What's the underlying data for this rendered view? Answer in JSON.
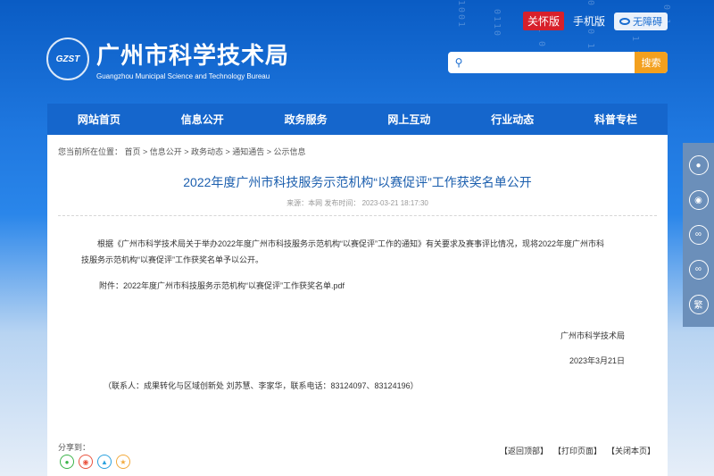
{
  "top": {
    "care_label": "关怀版",
    "mobile_label": "手机版",
    "access_label": "无障碍"
  },
  "logo": {
    "mark": "GZST",
    "name_cn": "广州市科学技术局",
    "name_en": "Guangzhou Municipal Science and Technology Bureau"
  },
  "search": {
    "placeholder": "",
    "button": "搜索"
  },
  "nav": [
    "网站首页",
    "信息公开",
    "政务服务",
    "网上互动",
    "行业动态",
    "科普专栏"
  ],
  "breadcrumb": "您当前所在位置： 首页 > 信息公开 > 政务动态 > 通知通告 > 公示信息",
  "article": {
    "title": "2022年度广州市科技服务示范机构“以赛促评”工作获奖名单公开",
    "meta": "来源：本网    发布时间：  2023-03-21 18:17:30",
    "para_line1": "根据《广州市科学技术局关于举办2022年度广州市科技服务示范机构“以赛促评”工作的通知》有关要求及赛事评比情况，现将2022年度广州市科",
    "para_line2": "技服务示范机构“以赛促评”工作获奖名单予以公开。",
    "attachment": "附件：2022年度广州市科技服务示范机构“以赛促评”工作获奖名单.pdf",
    "signature": "广州市科学技术局",
    "date": "2023年3月21日",
    "contact": "（联系人：成果转化与区域创新处 刘苏慧、李家华，联系电话：83124097、83124196）"
  },
  "share": {
    "label": "分享到："
  },
  "actions": {
    "top": "【返回顶部】",
    "print": "【打印页面】",
    "close": "【关闭本页】"
  },
  "float_bar": {
    "traditional": "繁"
  }
}
